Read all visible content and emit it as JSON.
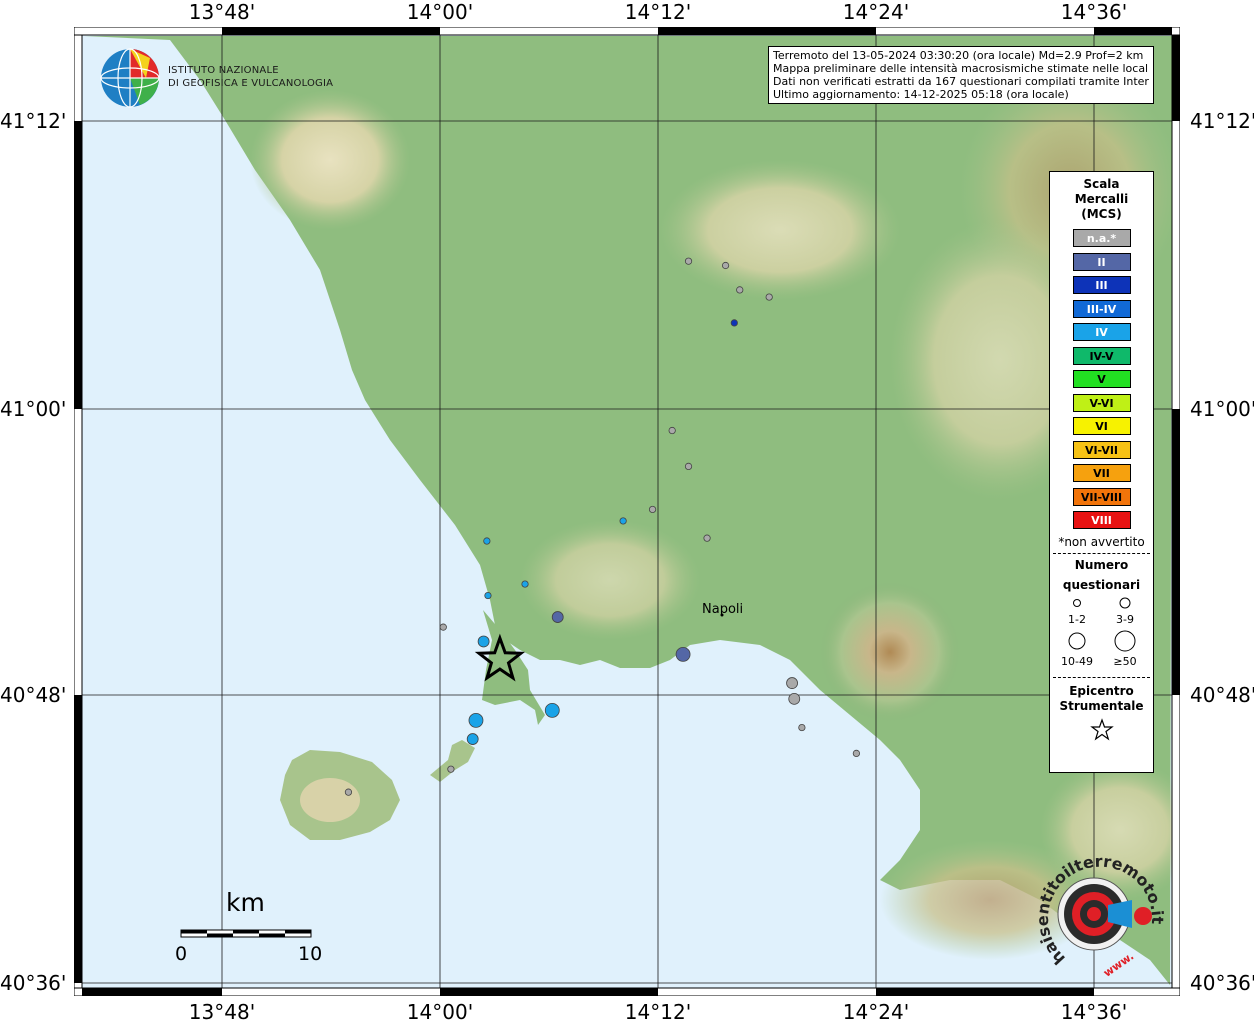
{
  "map": {
    "lon_labels": [
      "13°48'",
      "14°00'",
      "14°12'",
      "14°24'",
      "14°36'"
    ],
    "lat_labels": [
      "41°12'",
      "41°00'",
      "40°48'",
      "40°36'"
    ],
    "city": "Napoli"
  },
  "institute": {
    "line1": "ISTITUTO NAZIONALE",
    "line2": "DI GEOFISICA E VULCANOLOGIA"
  },
  "info": {
    "line1": "Terremoto del 13-05-2024 03:30:20 (ora locale) Md=2.9 Prof=2 km",
    "line2": "Mappa preliminare delle intensità macrosismiche stimate nelle località",
    "line3": "Dati non verificati estratti da 167 questionari compilati tramite Internet.",
    "line4": "Ultimo aggiornamento: 14-12-2025 05:18 (ora locale)"
  },
  "legend": {
    "title1": "Scala",
    "title2": "Mercalli",
    "title3": "(MCS)",
    "items": [
      {
        "label": "n.a.*",
        "color": "#a9a9a9",
        "text": "#ffffff"
      },
      {
        "label": "II",
        "color": "#5467a6",
        "text": "#ffffff"
      },
      {
        "label": "III",
        "color": "#0d33b8",
        "text": "#ffffff"
      },
      {
        "label": "III-IV",
        "color": "#1169d6",
        "text": "#ffffff"
      },
      {
        "label": "IV",
        "color": "#1aa3e8",
        "text": "#ffffff"
      },
      {
        "label": "IV-V",
        "color": "#0fb96a",
        "text": "#000000"
      },
      {
        "label": "V",
        "color": "#22e022",
        "text": "#000000"
      },
      {
        "label": "V-VI",
        "color": "#bff016",
        "text": "#000000"
      },
      {
        "label": "VI",
        "color": "#f7f200",
        "text": "#000000"
      },
      {
        "label": "VI-VII",
        "color": "#f6c215",
        "text": "#000000"
      },
      {
        "label": "VII",
        "color": "#f6a10e",
        "text": "#000000"
      },
      {
        "label": "VII-VIII",
        "color": "#f2740a",
        "text": "#000000"
      },
      {
        "label": "VIII",
        "color": "#e81212",
        "text": "#ffffff"
      }
    ],
    "not_felt": "*non avvertito",
    "count_title1": "Numero",
    "count_title2": "questionari",
    "sizes": [
      "1-2",
      "3-9",
      "10-49",
      "≥50"
    ],
    "epicenter1": "Epicentro",
    "epicenter2": "Strumentale"
  },
  "scale_bar": {
    "unit": "km",
    "min": "0",
    "max": "10"
  },
  "watermark": {
    "text": "haisentitoilterremoto.it",
    "url": "www."
  },
  "points": [
    {
      "lon": 14.228,
      "lat": 41.103,
      "intensity": "n.a.*",
      "class": "1-2"
    },
    {
      "lon": 14.262,
      "lat": 41.1,
      "intensity": "n.a.*",
      "class": "1-2"
    },
    {
      "lon": 14.275,
      "lat": 41.083,
      "intensity": "n.a.*",
      "class": "1-2"
    },
    {
      "lon": 14.302,
      "lat": 41.078,
      "intensity": "n.a.*",
      "class": "1-2"
    },
    {
      "lon": 14.27,
      "lat": 41.06,
      "intensity": "III",
      "class": "1-2"
    },
    {
      "lon": 14.213,
      "lat": 40.985,
      "intensity": "n.a.*",
      "class": "1-2"
    },
    {
      "lon": 14.228,
      "lat": 40.96,
      "intensity": "n.a.*",
      "class": "1-2"
    },
    {
      "lon": 14.195,
      "lat": 40.93,
      "intensity": "n.a.*",
      "class": "1-2"
    },
    {
      "lon": 14.168,
      "lat": 40.922,
      "intensity": "IV",
      "class": "1-2"
    },
    {
      "lon": 14.245,
      "lat": 40.91,
      "intensity": "n.a.*",
      "class": "1-2"
    },
    {
      "lon": 14.043,
      "lat": 40.908,
      "intensity": "IV",
      "class": "1-2"
    },
    {
      "lon": 14.078,
      "lat": 40.878,
      "intensity": "IV",
      "class": "1-2"
    },
    {
      "lon": 14.044,
      "lat": 40.87,
      "intensity": "IV",
      "class": "1-2"
    },
    {
      "lon": 14.108,
      "lat": 40.855,
      "intensity": "II",
      "class": "3-9"
    },
    {
      "lon": 14.003,
      "lat": 40.848,
      "intensity": "n.a.*",
      "class": "1-2"
    },
    {
      "lon": 14.04,
      "lat": 40.838,
      "intensity": "IV",
      "class": "3-9"
    },
    {
      "lon": 14.223,
      "lat": 40.829,
      "intensity": "II",
      "class": "10-49"
    },
    {
      "lon": 14.323,
      "lat": 40.809,
      "intensity": "n.a.*",
      "class": "3-9"
    },
    {
      "lon": 14.325,
      "lat": 40.798,
      "intensity": "n.a.*",
      "class": "3-9"
    },
    {
      "lon": 14.103,
      "lat": 40.79,
      "intensity": "IV",
      "class": "10-49"
    },
    {
      "lon": 14.033,
      "lat": 40.783,
      "intensity": "IV",
      "class": "10-49"
    },
    {
      "lon": 14.03,
      "lat": 40.77,
      "intensity": "IV",
      "class": "3-9"
    },
    {
      "lon": 14.332,
      "lat": 40.778,
      "intensity": "n.a.*",
      "class": "1-2"
    },
    {
      "lon": 14.382,
      "lat": 40.76,
      "intensity": "n.a.*",
      "class": "1-2"
    },
    {
      "lon": 13.916,
      "lat": 40.733,
      "intensity": "n.a.*",
      "class": "1-2"
    },
    {
      "lon": 14.01,
      "lat": 40.749,
      "intensity": "n.a.*",
      "class": "1-2"
    }
  ],
  "epicenter": {
    "lon": 14.055,
    "lat": 40.825
  }
}
